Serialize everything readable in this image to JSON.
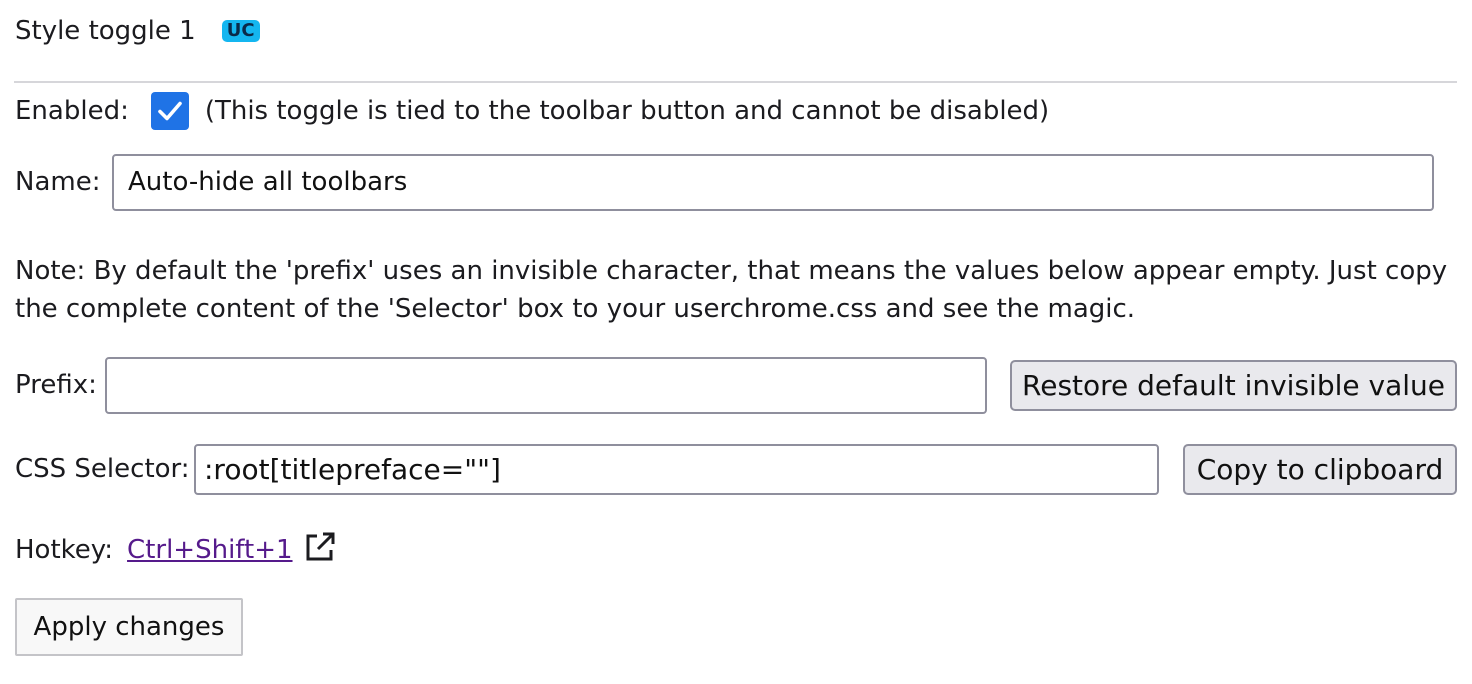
{
  "header": {
    "title": "Style toggle 1",
    "badge": "UC"
  },
  "enabled": {
    "label": "Enabled:",
    "checked": true,
    "note": "(This toggle is tied to the toolbar button and cannot be disabled)"
  },
  "name": {
    "label": "Name:",
    "value": "Auto-hide all toolbars"
  },
  "note_text": "Note: By default the 'prefix' uses an invisible character, that means the values below appear empty. Just copy the complete content of the 'Selector' box to your userchrome.css and see the magic.",
  "prefix": {
    "label": "Prefix:",
    "value": "",
    "restore_button": "Restore default invisible value"
  },
  "css_selector": {
    "label": "CSS Selector:",
    "value": ":root[titlepreface=\"\"]",
    "copy_button": "Copy to clipboard"
  },
  "hotkey": {
    "label": "Hotkey:",
    "link_text": "Ctrl+Shift+1",
    "icon": "external-link-icon"
  },
  "apply_button": "Apply changes",
  "colors": {
    "badge_bg": "#14b6f0",
    "checkbox_bg": "#1f73e6",
    "link": "#551a8b",
    "button_bg": "#e9e9ed"
  }
}
